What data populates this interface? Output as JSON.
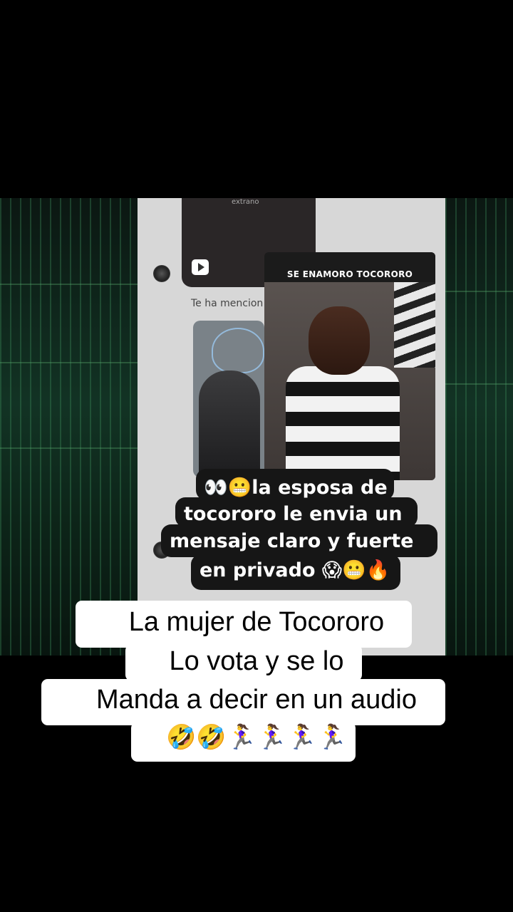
{
  "video": {
    "inset_title": "SE ENAMORO TOCORORO",
    "thumb_label": "extrano",
    "mention_text": "Te ha mencion",
    "caption_lines": [
      "👀😬la esposa de",
      "tocororo le envia un",
      "mensaje claro y fuerte",
      "en privado 😱😬🔥"
    ]
  },
  "subtitle_lines": [
    "La mujer de Tocororo",
    "Lo vota y se lo",
    "Manda a decir en un audio",
    "🤣🤣🏃‍♀️🏃‍♀️🏃‍♀️🏃‍♀️"
  ]
}
